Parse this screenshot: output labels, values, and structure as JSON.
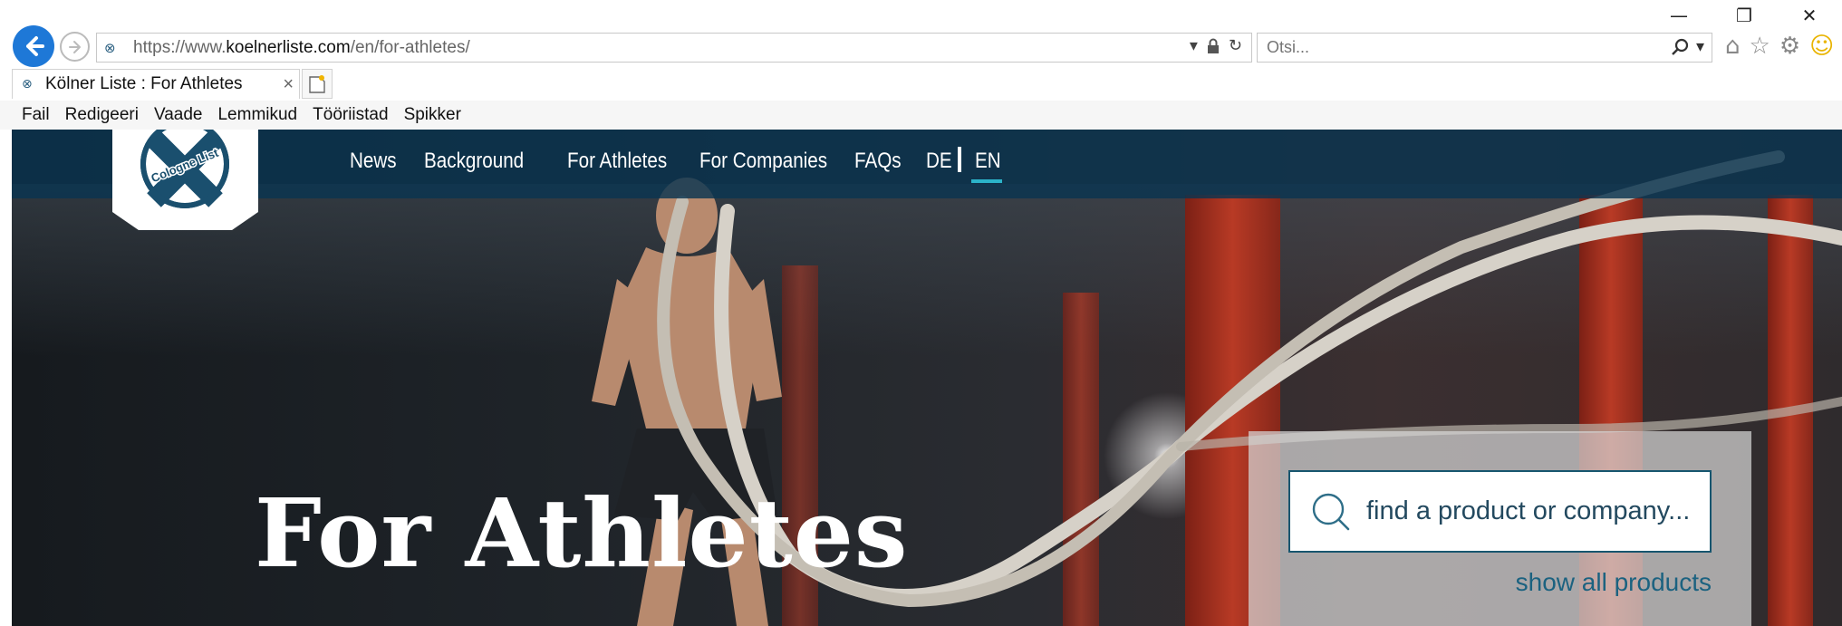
{
  "browser": {
    "window_controls": {
      "minimize": "—",
      "restore": "❐",
      "close": "✕"
    },
    "address": {
      "url_prefix": "https://www.",
      "url_domain": "koelnerliste.com",
      "url_path": "/en/for-athletes/"
    },
    "search_placeholder": "Otsi...",
    "tab": {
      "title": "Kölner Liste : For Athletes",
      "close": "×"
    },
    "menu": [
      "Fail",
      "Redigeeri",
      "Vaade",
      "Lemmikud",
      "Tööriistad",
      "Spikker"
    ],
    "icons": [
      "back-arrow-icon",
      "forward-arrow-icon",
      "site-icon",
      "dropdown-icon",
      "lock-icon",
      "refresh-icon",
      "search-icon",
      "home-icon",
      "favorites-star-icon",
      "settings-gear-icon",
      "feedback-smiley-icon",
      "new-tab-icon"
    ]
  },
  "site": {
    "logo_text": "Cologne List",
    "nav": {
      "news": "News",
      "background": "Background",
      "for_athletes": "For Athletes",
      "for_companies": "For Companies",
      "faqs": "FAQs",
      "de": "DE",
      "en": "EN",
      "active": "EN"
    },
    "hero_title": "For Athletes",
    "search": {
      "placeholder": "find a product or company...",
      "show_all": "show all products"
    },
    "colors": {
      "nav_bg": "#0a3450",
      "accent": "#2bb3c9",
      "link": "#1b6280"
    }
  }
}
